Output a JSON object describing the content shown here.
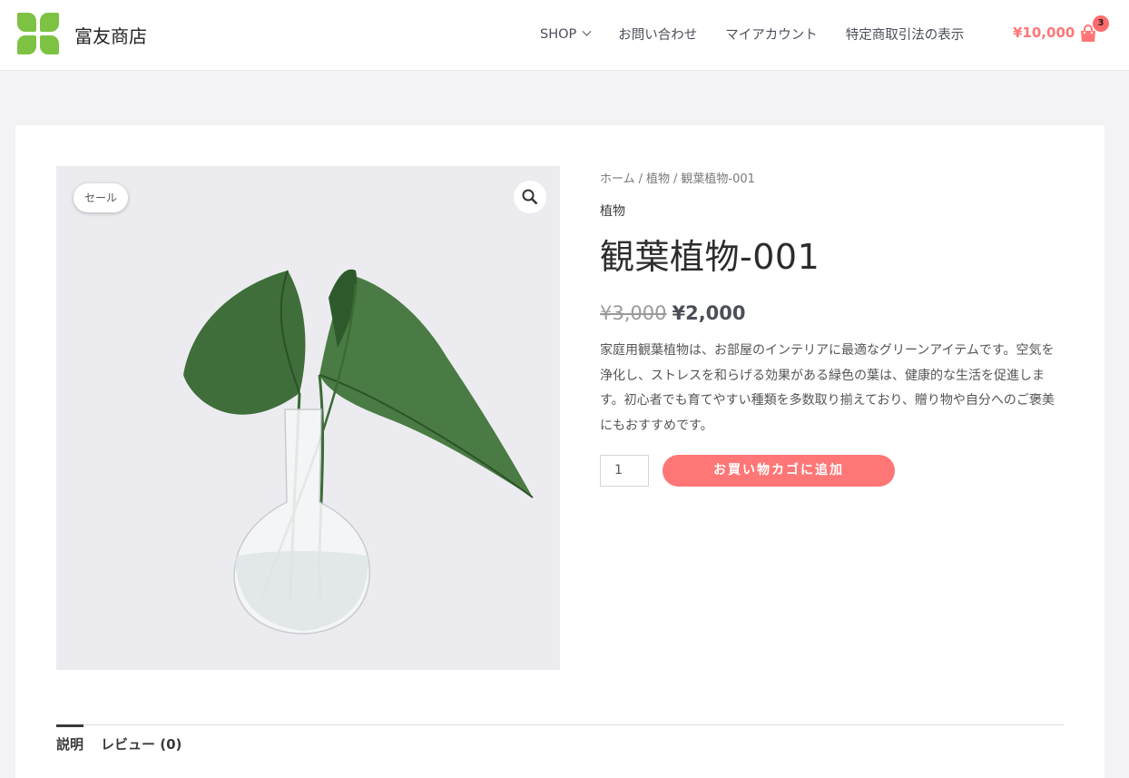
{
  "site": {
    "title": "富友商店"
  },
  "nav": {
    "items": [
      {
        "label": "SHOP"
      },
      {
        "label": "お問い合わせ"
      },
      {
        "label": "マイアカウント"
      },
      {
        "label": "特定商取引法の表示"
      }
    ]
  },
  "cart": {
    "total": "¥10,000",
    "count": "3"
  },
  "product": {
    "sale_badge": "セール",
    "breadcrumb": [
      "ホーム",
      "植物",
      "観葉植物-001"
    ],
    "breadcrumb_sep": "/",
    "category": "植物",
    "title": "観葉植物-001",
    "price_old": "¥3,000",
    "price_new": "¥2,000",
    "description": "家庭用観葉植物は、お部屋のインテリアに最適なグリーンアイテムです。空気を浄化し、ストレスを和らげる効果がある緑色の葉は、健康的な生活を促進します。初心者でも育てやすい種類を多数取り揃えており、贈り物や自分へのご褒美にもおすすめです。",
    "quantity": "1",
    "add_to_cart": "お買い物カゴに追加"
  },
  "tabs": [
    {
      "label": "説明"
    },
    {
      "label": "レビュー (0)"
    }
  ],
  "colors": {
    "accent": "#ff7676",
    "logo": "#7dc242"
  }
}
